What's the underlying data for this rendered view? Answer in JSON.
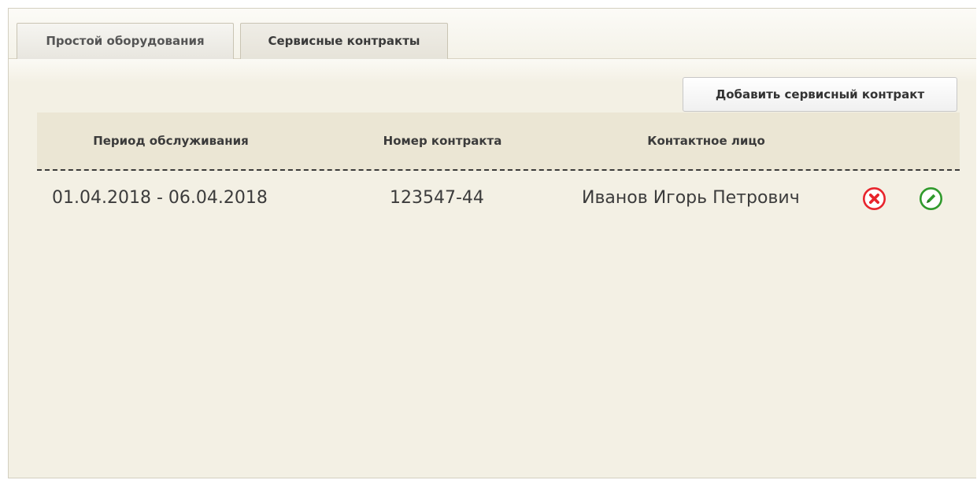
{
  "tabs": [
    {
      "label": "Простой оборудования",
      "active": false
    },
    {
      "label": "Сервисные контракты",
      "active": true
    }
  ],
  "toolbar": {
    "add_label": "Добавить сервисный контракт"
  },
  "table": {
    "columns": [
      "Период обслуживания",
      "Номер контракта",
      "Контактное лицо"
    ],
    "rows": [
      {
        "period": "01.04.2018 - 06.04.2018",
        "contract_number": "123547-44",
        "contact_person": "Иванов Игорь Петрович",
        "actions": [
          "delete-icon",
          "edit-icon"
        ]
      }
    ]
  },
  "colors": {
    "background": "#f3f0e4",
    "header": "#ebe6d4",
    "delete": "#e8242c",
    "edit": "#2f9a2c"
  }
}
